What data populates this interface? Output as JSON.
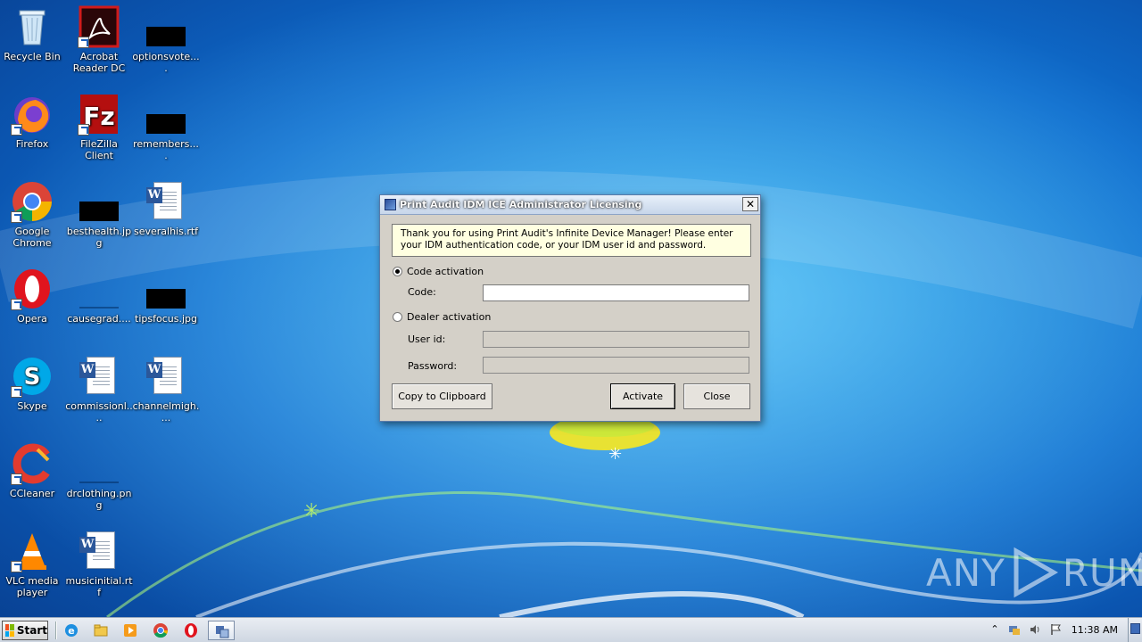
{
  "desktop": {
    "icons": [
      {
        "label": "Recycle Bin",
        "icon": "recycle-bin-icon"
      },
      {
        "label": "Acrobat Reader DC",
        "icon": "acrobat-icon"
      },
      {
        "label": "optionsvote....",
        "icon": "redacted-thumbnail"
      },
      {
        "label": "Firefox",
        "icon": "firefox-icon"
      },
      {
        "label": "FileZilla Client",
        "icon": "filezilla-icon"
      },
      {
        "label": "remembers....",
        "icon": "redacted-thumbnail"
      },
      {
        "label": "Google Chrome",
        "icon": "chrome-icon"
      },
      {
        "label": "besthealth.jpg",
        "icon": "redacted-thumbnail"
      },
      {
        "label": "severalhis.rtf",
        "icon": "word-document-icon"
      },
      {
        "label": "Opera",
        "icon": "opera-icon"
      },
      {
        "label": "causegrad....",
        "icon": "image-thumbnail"
      },
      {
        "label": "tipsfocus.jpg",
        "icon": "redacted-thumbnail"
      },
      {
        "label": "Skype",
        "icon": "skype-icon"
      },
      {
        "label": "commissionl....",
        "icon": "word-document-icon"
      },
      {
        "label": "channelmigh....",
        "icon": "word-document-icon"
      },
      {
        "label": "CCleaner",
        "icon": "ccleaner-icon"
      },
      {
        "label": "drclothing.png",
        "icon": "image-thumbnail"
      },
      {
        "label": "VLC media player",
        "icon": "vlc-icon"
      },
      {
        "label": "musicinitial.rtf",
        "icon": "word-document-icon"
      }
    ]
  },
  "dialog": {
    "title": "Print Audit IDM ICE Administrator Licensing",
    "close_glyph": "✕",
    "info_text": "Thank you for using Print Audit's Infinite Device Manager! Please enter your IDM authentication code, or your IDM user id and password.",
    "code_activation_label": "Code activation",
    "code_label": "Code:",
    "code_value": "",
    "dealer_activation_label": "Dealer activation",
    "userid_label": "User id:",
    "userid_value": "",
    "password_label": "Password:",
    "password_value": "",
    "copy_button": "Copy to Clipboard",
    "activate_button": "Activate",
    "close_button": "Close",
    "selected_mode": "code"
  },
  "watermark": {
    "text_left": "ANY",
    "text_right": "RUN"
  },
  "taskbar": {
    "start_label": "Start",
    "pinned": [
      "internet-explorer-icon",
      "file-explorer-icon",
      "media-player-icon",
      "chrome-icon",
      "opera-icon",
      "licensing-app-icon"
    ],
    "clock": "11:38 AM"
  },
  "colors": {
    "accent": "#0b63c6",
    "info_bg": "#ffffe1",
    "dialog_bg": "#d4d0c8"
  }
}
